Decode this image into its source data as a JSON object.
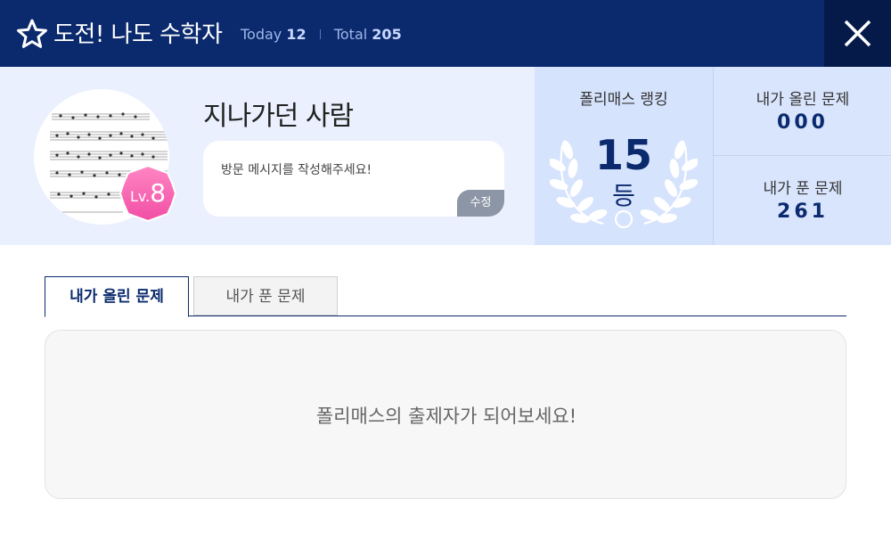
{
  "header": {
    "title": "도전! 나도 수학자",
    "today_label": "Today",
    "today_count": "12",
    "total_label": "Total",
    "total_count": "205",
    "star_icon": "star-outline-icon",
    "close_icon": "close-icon"
  },
  "profile": {
    "nickname": "지나가던 사람",
    "level_prefix": "Lv.",
    "level_value": "8",
    "message_placeholder": "방문 메시지를 작성해주세요!",
    "edit_label": "수정",
    "avatar_icon": "sheet-music-avatar"
  },
  "ranking": {
    "label": "폴리매스 랭킹",
    "rank": "15",
    "unit": "등"
  },
  "counts": {
    "uploaded_label": "내가 올린 문제",
    "uploaded_value": "000",
    "solved_label": "내가 푼 문제",
    "solved_value": "261"
  },
  "tabs": [
    {
      "label": "내가 올린 문제",
      "active": true
    },
    {
      "label": "내가 푼 문제",
      "active": false
    }
  ],
  "panel": {
    "empty_message": "폴리매스의 출제자가 되어보세요!"
  },
  "colors": {
    "header_bg": "#0b2a6e",
    "close_bg": "#061a4a",
    "profile_bg": "#eaf0fd",
    "ranking_bg": "#d6e3fd",
    "badge_pink": "#f765b0",
    "accent_navy": "#0b2a6e"
  }
}
